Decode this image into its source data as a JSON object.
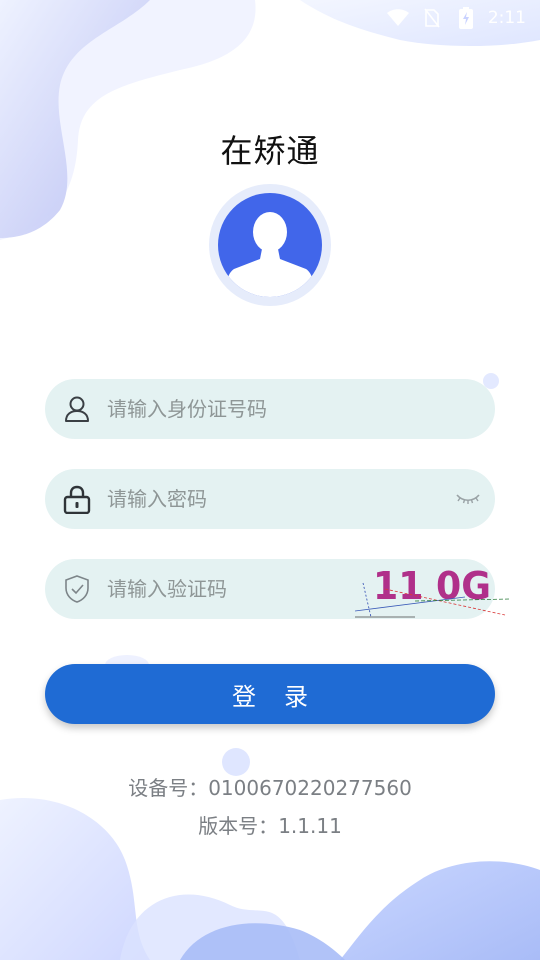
{
  "status_bar": {
    "time": "2:11"
  },
  "app": {
    "title": "在矫通"
  },
  "form": {
    "id_placeholder": "请输入身份证号码",
    "password_placeholder": "请输入密码",
    "captcha_placeholder": "请输入验证码",
    "captcha_text": "11 0G",
    "login_label": "登录"
  },
  "footer": {
    "device_label": "设备号：",
    "device_value": "0100670220277560",
    "version_label": "版本号：",
    "version_value": "1.1.11"
  },
  "icons": {
    "user": "user-icon",
    "lock": "lock-icon",
    "shield": "shield-check-icon",
    "eye": "eye-closed-icon",
    "avatar": "avatar-person-icon"
  },
  "colors": {
    "primary": "#1f6bd4",
    "avatar_bg": "#4166ea",
    "field_bg": "#e4f2f2",
    "footer_text": "#7b7f84"
  }
}
